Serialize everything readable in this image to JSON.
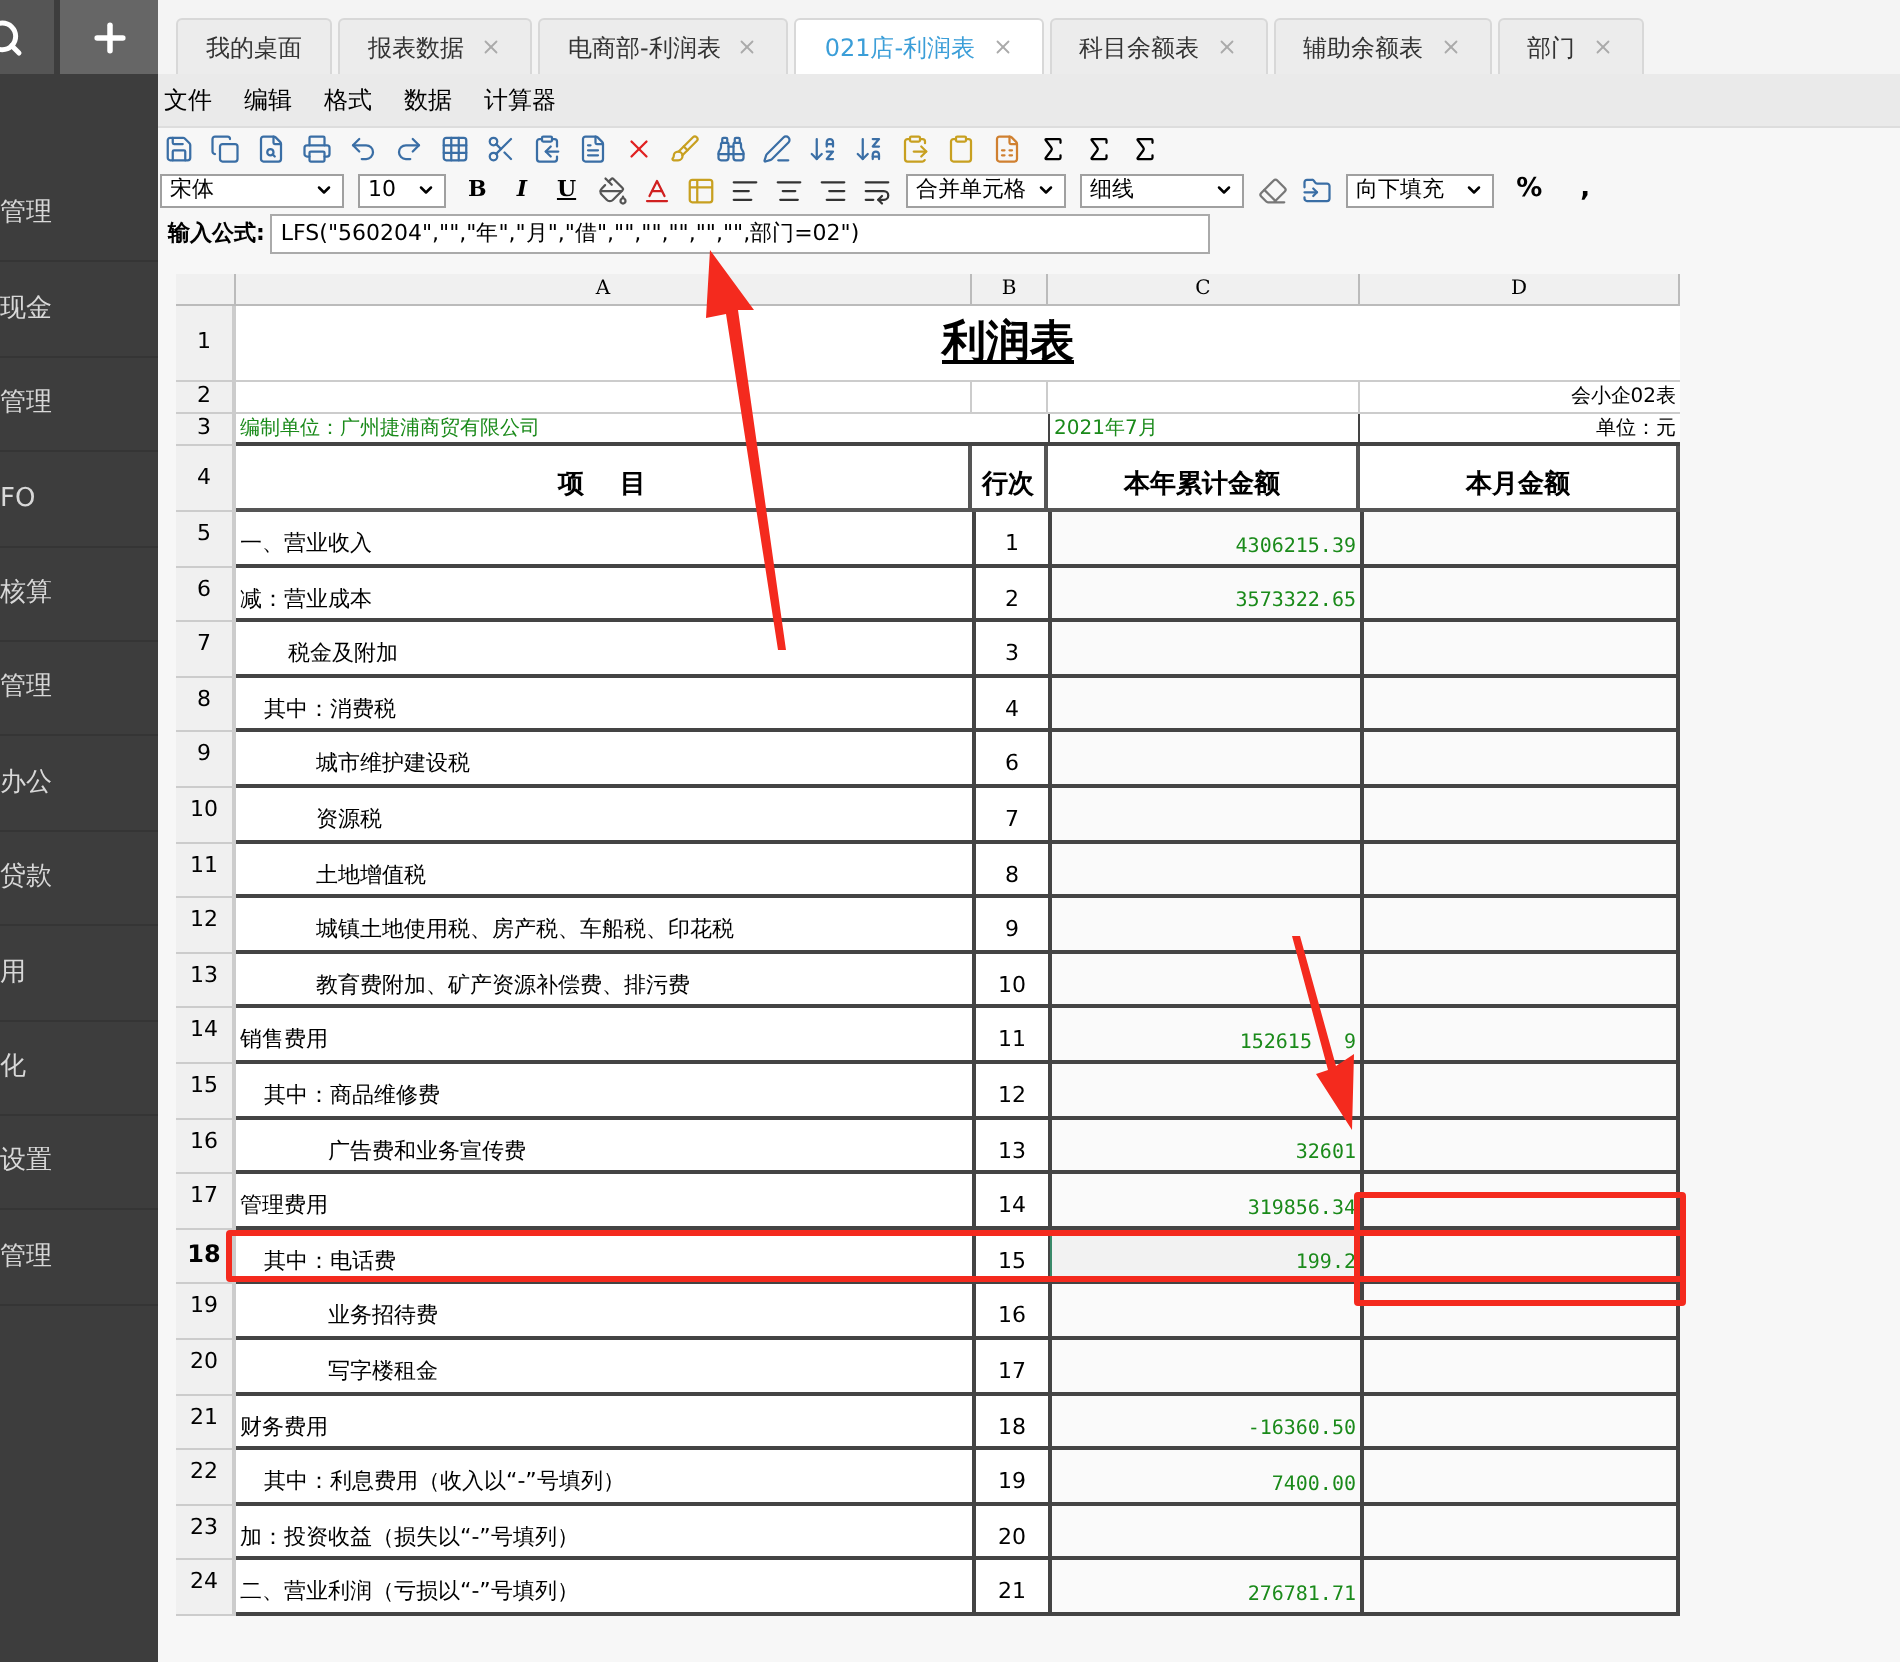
{
  "sidebar": {
    "items": [
      {
        "label": "管理",
        "selected": false
      },
      {
        "label": "现金",
        "selected": false
      },
      {
        "label": "管理",
        "selected": false
      },
      {
        "label": "FO",
        "selected": false
      },
      {
        "label": "核算",
        "selected": false
      },
      {
        "label": "管理",
        "selected": false
      },
      {
        "label": "办公",
        "selected": false
      },
      {
        "label": "贷款",
        "selected": false
      },
      {
        "label": "用",
        "selected": false
      },
      {
        "label": "化",
        "selected": false
      },
      {
        "label": "设置",
        "selected": false
      },
      {
        "label": "管理",
        "selected": false
      }
    ]
  },
  "tabs": [
    {
      "label": "我的桌面",
      "selected": false,
      "closable": false
    },
    {
      "label": "报表数据",
      "selected": false,
      "closable": true
    },
    {
      "label": "电商部-利润表",
      "selected": false,
      "closable": true
    },
    {
      "label": "021店-利润表",
      "selected": true,
      "closable": true
    },
    {
      "label": "科目余额表",
      "selected": false,
      "closable": true
    },
    {
      "label": "辅助余额表",
      "selected": false,
      "closable": true
    },
    {
      "label": "部门",
      "selected": false,
      "closable": true
    }
  ],
  "menu": [
    "文件",
    "编辑",
    "格式",
    "数据",
    "计算器"
  ],
  "format_bar": {
    "font": "宋体",
    "size": "10",
    "bold": "B",
    "italic": "I",
    "underline": "U",
    "merge": "合并单元格",
    "line": "细线",
    "fill": "向下填充",
    "percent": "%",
    "comma": ","
  },
  "formula": {
    "label": "输入公式:",
    "value": "LFS(\"560204\",\"\",\"年\",\"月\",\"借\",\"\",\"\",\"\",\"\",\"\",部门=02\")"
  },
  "sheet": {
    "columns": [
      "A",
      "B",
      "C",
      "D"
    ],
    "title": "利润表",
    "form_code": "会小企02表",
    "company": "编制单位：广州捷浦商贸有限公司",
    "period": "2021年7月",
    "unit": "单位：元",
    "headers": [
      "项    目",
      "行次",
      "本年累计金额",
      "本月金额"
    ],
    "header_row_numbers": [
      "1",
      "2",
      "3",
      "4"
    ],
    "rows": [
      {
        "num": "5",
        "kind": "top",
        "item": "一、营业收入",
        "line": "1",
        "ytd": "4306215.39",
        "selected": false
      },
      {
        "num": "6",
        "kind": "top",
        "item": "减：营业成本",
        "line": "2",
        "ytd": "3573322.65",
        "selected": false
      },
      {
        "num": "7",
        "kind": "item",
        "item": "税金及附加",
        "line": "3",
        "selected": false
      },
      {
        "num": "8",
        "kind": "sub",
        "item": "其中：消费税",
        "line": "4",
        "selected": false
      },
      {
        "num": "9",
        "kind": "detail",
        "item": "城市维护建设税",
        "line": "6",
        "selected": false
      },
      {
        "num": "10",
        "kind": "detail",
        "item": "资源税",
        "line": "7",
        "selected": false
      },
      {
        "num": "11",
        "kind": "detail",
        "item": "土地增值税",
        "line": "8",
        "selected": false
      },
      {
        "num": "12",
        "kind": "detail",
        "item": "城镇土地使用税、房产税、车船税、印花税",
        "line": "9",
        "selected": false
      },
      {
        "num": "13",
        "kind": "detail",
        "item": "教育费附加、矿产资源补偿费、排污费",
        "line": "10",
        "selected": false
      },
      {
        "num": "14",
        "kind": "top",
        "item": "销售费用",
        "line": "11",
        "ytd": "152615",
        "ytd_end": "9",
        "selected": false
      },
      {
        "num": "15",
        "kind": "sub",
        "item": "其中：商品维修费",
        "line": "12",
        "selected": false
      },
      {
        "num": "16",
        "kind": "deep",
        "item": "广告费和业务宣传费",
        "line": "13",
        "ytd": "32601",
        "selected": false
      },
      {
        "num": "17",
        "kind": "top",
        "item": "管理费用",
        "line": "14",
        "ytd": "319856.34",
        "selected": false
      },
      {
        "num": "18",
        "kind": "sub",
        "item": "其中：电话费",
        "line": "15",
        "ytd": "199.2",
        "selected": true
      },
      {
        "num": "19",
        "kind": "deep",
        "item": "业务招待费",
        "line": "16",
        "selected": false
      },
      {
        "num": "20",
        "kind": "deep",
        "item": "写字楼租金",
        "line": "17",
        "selected": false
      },
      {
        "num": "21",
        "kind": "top",
        "item": "财务费用",
        "line": "18",
        "ytd": "-16360.50",
        "selected": false
      },
      {
        "num": "22",
        "kind": "sub",
        "item": "其中：利息费用（收入以“-”号填列）",
        "line": "19",
        "ytd": "7400.00",
        "selected": false
      },
      {
        "num": "23",
        "kind": "top",
        "item": "加：投资收益（损失以“-”号填列）",
        "line": "20",
        "selected": false
      },
      {
        "num": "24",
        "kind": "top",
        "item": "二、营业利润（亏损以“-”号填列）",
        "line": "21",
        "ytd": "276781.71",
        "selected": false
      }
    ]
  }
}
